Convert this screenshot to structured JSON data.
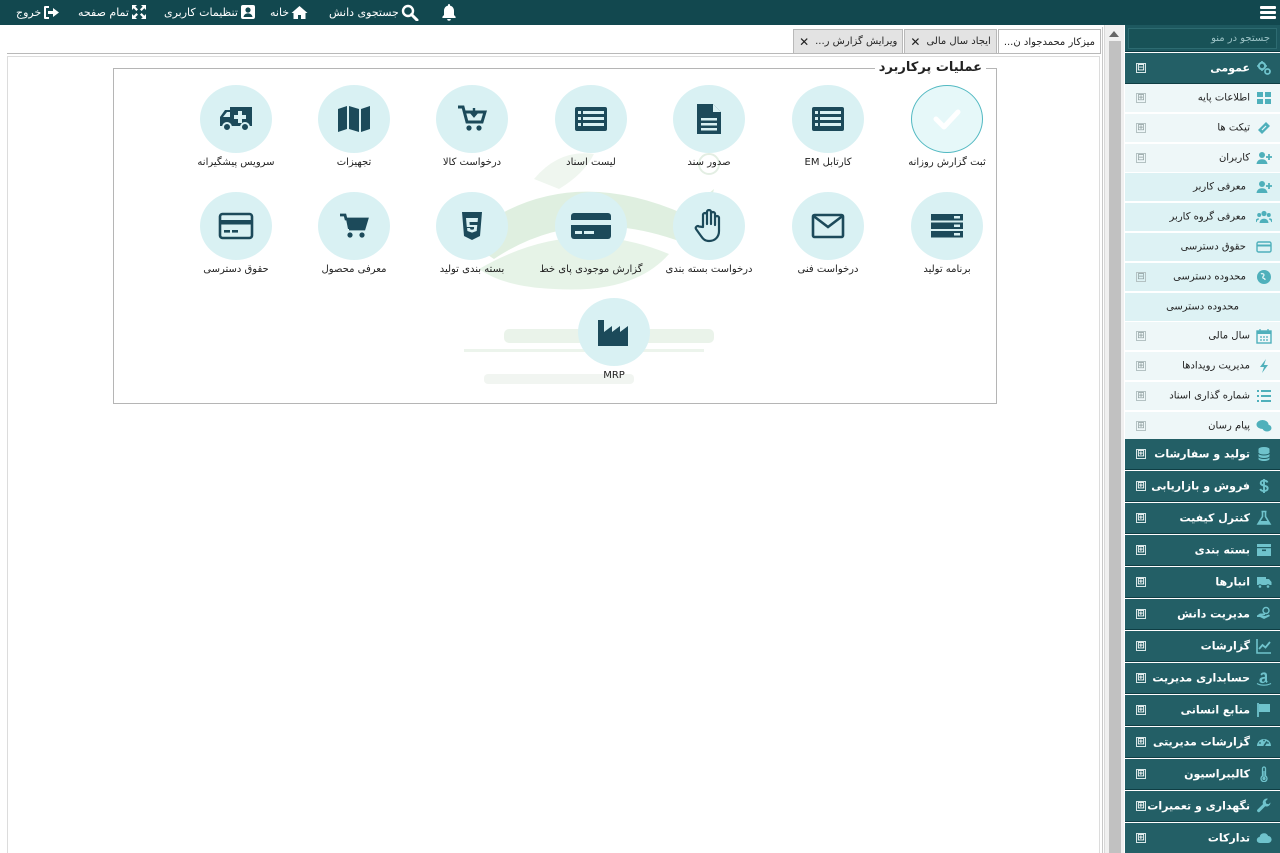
{
  "topbar": {
    "logout": "خروج",
    "fullscreen": "تمام صفحه",
    "user_settings": "تنظیمات کاربری",
    "home": "خانه",
    "knowledge_search": "جستجوی دانش"
  },
  "tabs": [
    {
      "label": "میزکار محمدجواد ن..."
    },
    {
      "label": "ایجاد سال مالی"
    },
    {
      "label": "ویرایش گزارش ر..."
    }
  ],
  "close_glyph": "✕",
  "panel": {
    "legend": "عملیات پرکاربرد",
    "actions": [
      {
        "label": "ثبت گزارش روزانه",
        "icon": "check-icon"
      },
      {
        "label": "کارتابل EM",
        "icon": "list-icon"
      },
      {
        "label": "صدور سند",
        "icon": "document-icon"
      },
      {
        "label": "لیست اسناد",
        "icon": "list-icon"
      },
      {
        "label": "درخواست کالا",
        "icon": "cart-download-icon"
      },
      {
        "label": "تجهیزات",
        "icon": "map-icon"
      },
      {
        "label": "سرویس پیشگیرانه",
        "icon": "ambulance-icon"
      },
      {
        "label": "برنامه تولید",
        "icon": "server-icon"
      },
      {
        "label": "درخواست فنی",
        "icon": "envelope-icon"
      },
      {
        "label": "درخواست بسته بندی",
        "icon": "hand-icon"
      },
      {
        "label": "گزارش موجودی پای خط",
        "icon": "credit-card-icon"
      },
      {
        "label": "بسته بندی تولید",
        "icon": "css3-icon"
      },
      {
        "label": "معرفی محصول",
        "icon": "cart-icon"
      },
      {
        "label": "حقوق دسترسی",
        "icon": "card-icon"
      },
      {
        "label": "MRP",
        "icon": "factory-icon"
      }
    ]
  },
  "sidebar": {
    "search_placeholder": "جستجو در منو",
    "toggle_open": "⊟",
    "toggle_closed": "⊞",
    "general": "عمومی",
    "general_items": [
      {
        "label": "اطلاعات پایه",
        "icon": "grid-icon"
      },
      {
        "label": "تیکت ها",
        "icon": "ticket-icon"
      },
      {
        "label": "کاربران",
        "icon": "user-plus-icon"
      }
    ],
    "user_items": [
      {
        "label": "معرفی کاربر",
        "icon": "user-plus-icon"
      },
      {
        "label": "معرفی گروه کاربر",
        "icon": "users-icon"
      },
      {
        "label": "حقوق دسترسی",
        "icon": "card-icon"
      },
      {
        "label": "محدوده دسترسی",
        "icon": "globe-icon"
      }
    ],
    "access_scope_child": "محدوده دسترسی",
    "general_items_2": [
      {
        "label": "سال مالی",
        "icon": "calendar-icon"
      },
      {
        "label": "مدیریت رویدادها",
        "icon": "bolt-icon"
      },
      {
        "label": "شماره گذاری اسناد",
        "icon": "numbered-list-icon"
      },
      {
        "label": "پیام رسان",
        "icon": "chat-icon"
      }
    ],
    "sections": [
      {
        "label": "تولید و سفارشات",
        "icon": "database-icon"
      },
      {
        "label": "فروش و بازاریابی",
        "icon": "dollar-icon"
      },
      {
        "label": "کنترل کیفیت",
        "icon": "flask-icon"
      },
      {
        "label": "بسته بندی",
        "icon": "box-icon"
      },
      {
        "label": "انبارها",
        "icon": "truck-icon"
      },
      {
        "label": "مدیریت دانش",
        "icon": "hand-money-icon"
      },
      {
        "label": "گزارشات",
        "icon": "line-chart-icon"
      },
      {
        "label": "حسابداری مدیریت",
        "icon": "amazon-icon"
      },
      {
        "label": "منابع انسانی",
        "icon": "flag-icon"
      },
      {
        "label": "گزارشات مدیریتی",
        "icon": "dashboard-icon"
      },
      {
        "label": "کالیبراسیون",
        "icon": "thermometer-icon"
      },
      {
        "label": "نگهداری و تعمیرات",
        "icon": "wrench-icon"
      },
      {
        "label": "تدارکات",
        "icon": "cloud-icon"
      }
    ]
  }
}
